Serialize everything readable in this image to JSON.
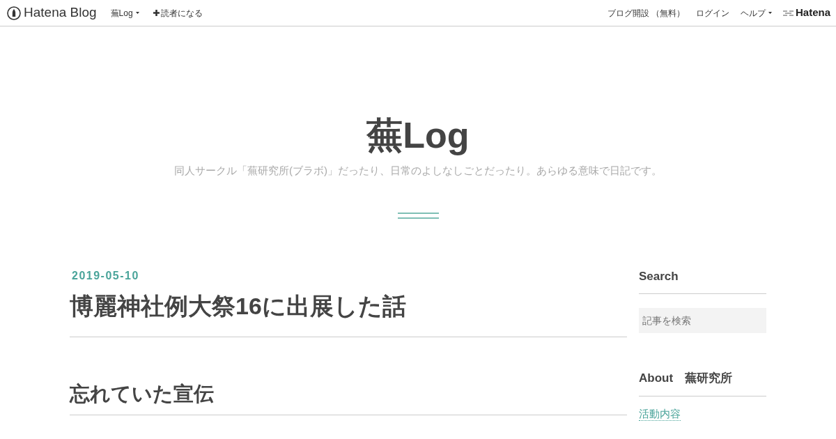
{
  "navbar": {
    "logo": "Hatena Blog",
    "left_items": [
      {
        "label": "蕪Log",
        "kind": "dropdown"
      },
      {
        "label": "読者になる",
        "kind": "plus"
      }
    ],
    "right_items": [
      {
        "label": "ブログ開設 （無料）",
        "kind": "link"
      },
      {
        "label": "ログイン",
        "kind": "link"
      },
      {
        "label": "ヘルプ",
        "kind": "dropdown"
      }
    ],
    "brand": "Hatena"
  },
  "header": {
    "title": "蕪Log",
    "description": "同人サークル「蕪研究所(ブラボ)」だったり、日常のよしなしごとだったり。あらゆる意味で日記です。"
  },
  "article": {
    "date": "2019-05-10",
    "title": "博麗神社例大祭16に出展した話",
    "section_heading": "忘れていた宣伝"
  },
  "sidebar": {
    "modules": [
      {
        "kind": "search",
        "title": "Search",
        "placeholder": "記事を検索"
      },
      {
        "kind": "links",
        "title": "About　蕪研究所",
        "links": [
          "活動内容"
        ]
      }
    ]
  }
}
